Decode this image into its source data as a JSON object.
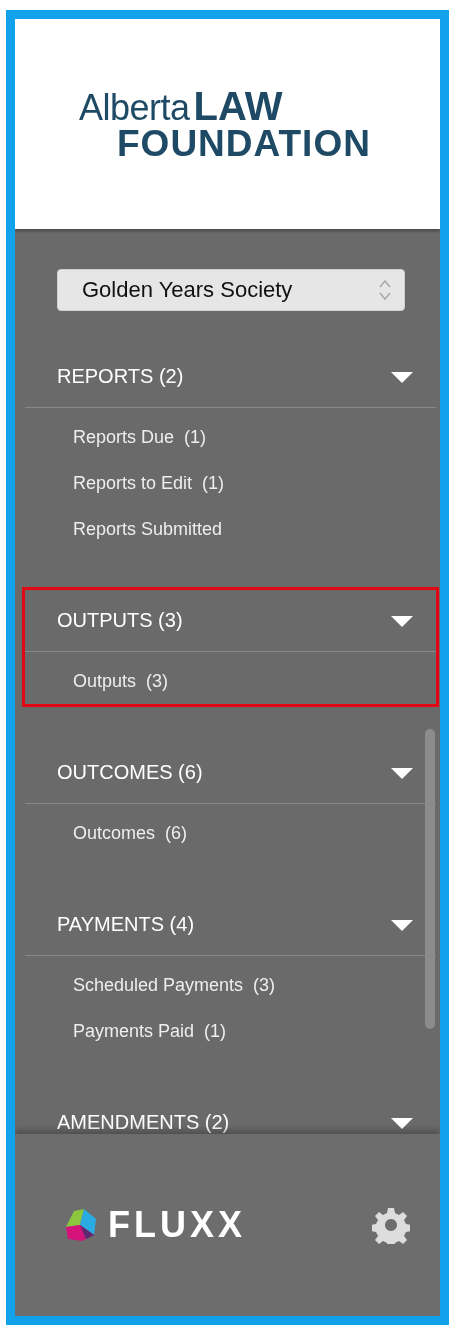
{
  "logo": {
    "light": "Alberta",
    "bold": "LAW",
    "line2": "FOUNDATION"
  },
  "organization_select": {
    "value": "Golden Years Society"
  },
  "sections": [
    {
      "title": "REPORTS (2)",
      "expanded": true,
      "highlighted": false,
      "items": [
        "Reports Due  (1)",
        "Reports to Edit  (1)",
        "Reports Submitted"
      ]
    },
    {
      "title": "OUTPUTS (3)",
      "expanded": true,
      "highlighted": true,
      "items": [
        "Outputs  (3)"
      ]
    },
    {
      "title": "OUTCOMES (6)",
      "expanded": true,
      "highlighted": false,
      "items": [
        "Outcomes  (6)"
      ]
    },
    {
      "title": "PAYMENTS (4)",
      "expanded": true,
      "highlighted": false,
      "items": [
        "Scheduled Payments  (3)",
        "Payments Paid  (1)"
      ]
    },
    {
      "title": "AMENDMENTS (2)",
      "expanded": true,
      "highlighted": false
    }
  ],
  "footer": {
    "brand": "FLUXX"
  }
}
